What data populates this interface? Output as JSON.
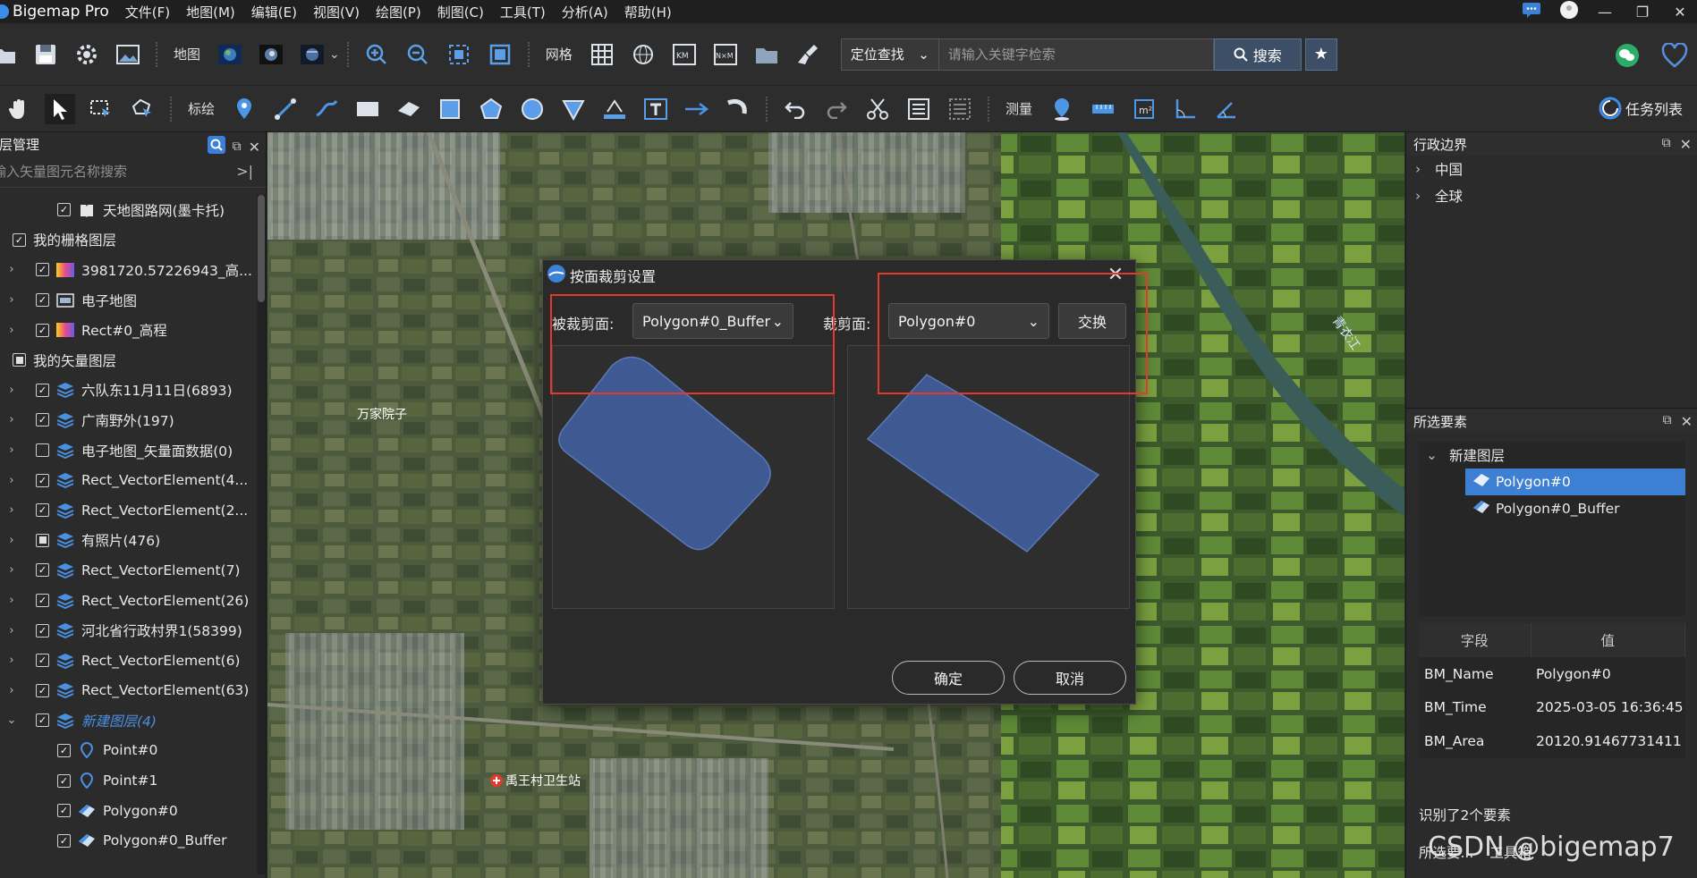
{
  "app": {
    "title": "Bigemap Pro"
  },
  "menu": [
    "文件(F)",
    "地图(M)",
    "编辑(E)",
    "视图(V)",
    "绘图(P)",
    "制图(C)",
    "工具(T)",
    "分析(A)",
    "帮助(H)"
  ],
  "toolbar1": {
    "map_label": "地图",
    "grid_label": "网格",
    "search_scope": "定位查找",
    "search_placeholder": "请输入关键字检索",
    "search_button": "搜索"
  },
  "toolbar2": {
    "annotate_label": "标绘",
    "measure_label": "测量",
    "task_list": "任务列表"
  },
  "layer_panel": {
    "title": "图层管理",
    "search_placeholder": "输入矢量图元名称搜索",
    "rows": [
      {
        "label": "天地图路网(墨卡托)",
        "icon": "map-book-icon"
      },
      {
        "label": "我的栅格图层",
        "icon": ""
      },
      {
        "label": "3981720.57226943_高...",
        "icon": "raster-gradient-icon"
      },
      {
        "label": "电子地图",
        "icon": "map-tile-icon"
      },
      {
        "label": "Rect#0_高程",
        "icon": "raster-gradient-icon"
      },
      {
        "label": "我的矢量图层",
        "icon": ""
      },
      {
        "label": "六队东11月11日(6893)",
        "icon": "layers-icon"
      },
      {
        "label": "广南野外(197)",
        "icon": "layers-icon"
      },
      {
        "label": "电子地图_矢量面数据(0)",
        "icon": "layers-icon"
      },
      {
        "label": "Rect_VectorElement(4...",
        "icon": "layers-icon"
      },
      {
        "label": "Rect_VectorElement(2...",
        "icon": "layers-icon"
      },
      {
        "label": "有照片(476)",
        "icon": "layers-icon"
      },
      {
        "label": "Rect_VectorElement(7)",
        "icon": "layers-icon"
      },
      {
        "label": "Rect_VectorElement(26)",
        "icon": "layers-icon"
      },
      {
        "label": "河北省行政村界1(58399)",
        "icon": "layers-icon"
      },
      {
        "label": "Rect_VectorElement(6)",
        "icon": "layers-icon"
      },
      {
        "label": "Rect_VectorElement(63)",
        "icon": "layers-icon"
      },
      {
        "label": "新建图层(4)",
        "icon": "layers-icon"
      },
      {
        "label": "Point#0",
        "icon": "pin-icon"
      },
      {
        "label": "Point#1",
        "icon": "pin-icon"
      },
      {
        "label": "Polygon#0",
        "icon": "polygon-icon"
      },
      {
        "label": "Polygon#0_Buffer",
        "icon": "polygon-icon"
      }
    ]
  },
  "map": {
    "labels": [
      "万家院子",
      "禹王村卫生站",
      "青衣江"
    ]
  },
  "dialog": {
    "title": "按面裁剪设置",
    "clipped_label": "被裁剪面:",
    "clipped_value": "Polygon#0_Buffer",
    "clipper_label": "裁剪面:",
    "clipper_value": "Polygon#0",
    "swap": "交换",
    "ok": "确定",
    "cancel": "取消",
    "shape_color": "#3f5a93"
  },
  "admin_panel": {
    "title": "行政边界",
    "items": [
      "中国",
      "全球"
    ]
  },
  "selected_panel": {
    "title": "所选要素",
    "layer": "新建图层",
    "items": [
      "Polygon#0",
      "Polygon#0_Buffer"
    ],
    "table_headers": [
      "字段",
      "值"
    ],
    "rows": [
      [
        "BM_Name",
        "Polygon#0"
      ],
      [
        "BM_Time",
        "2025-03-05 16:36:45"
      ],
      [
        "BM_Area",
        "20120.91467731411"
      ]
    ],
    "identified": "识别了2个要素",
    "tabs": [
      "所选要...",
      "工具箱"
    ]
  },
  "watermark": "CSDN @bigemap7"
}
